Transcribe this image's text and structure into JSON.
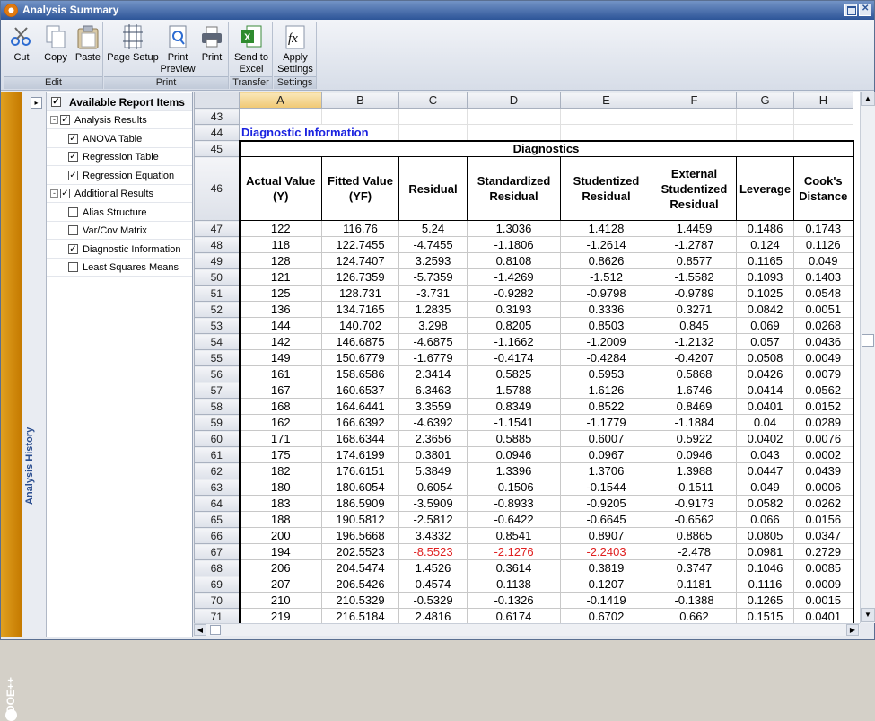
{
  "window": {
    "title": "Analysis Summary"
  },
  "ribbon": {
    "groups": [
      {
        "label": "Edit",
        "buttons": [
          "Cut",
          "Copy",
          "Paste"
        ]
      },
      {
        "label": "Print",
        "buttons": [
          "Page Setup",
          "Print Preview",
          "Print"
        ]
      },
      {
        "label": "Transfer",
        "buttons": [
          "Send to Excel"
        ]
      },
      {
        "label": "Settings",
        "buttons": [
          "Apply Settings"
        ]
      }
    ]
  },
  "sidebar": {
    "history_label": "Analysis History",
    "brand": "DOE++"
  },
  "tree": {
    "header": "Available Report Items",
    "items": [
      {
        "label": "Analysis Results",
        "checked": true,
        "level": 0,
        "expander": "-"
      },
      {
        "label": "ANOVA Table",
        "checked": true,
        "level": 1
      },
      {
        "label": "Regression Table",
        "checked": true,
        "level": 1
      },
      {
        "label": "Regression Equation",
        "checked": true,
        "level": 1
      },
      {
        "label": "Additional Results",
        "checked": true,
        "level": 0,
        "expander": "-"
      },
      {
        "label": "Alias Structure",
        "checked": false,
        "level": 1
      },
      {
        "label": "Var/Cov Matrix",
        "checked": false,
        "level": 1
      },
      {
        "label": "Diagnostic Information",
        "checked": true,
        "level": 1
      },
      {
        "label": "Least Squares Means",
        "checked": false,
        "level": 1
      }
    ]
  },
  "sheet": {
    "columns": [
      "A",
      "B",
      "C",
      "D",
      "E",
      "F",
      "G",
      "H"
    ],
    "selected_column": "A",
    "row_43": "43",
    "row_44": "44",
    "row_45": "45",
    "row_46": "46",
    "section_title": "Diagnostic Information",
    "caption": "Diagnostics",
    "headers": [
      "Actual Value (Y)",
      "Fitted Value (YF)",
      "Residual",
      "Standardized Residual",
      "Studentized Residual",
      "External Studentized Residual",
      "Leverage",
      "Cook's Distance"
    ],
    "negative_color": "#e02020",
    "rows": [
      {
        "n": "47",
        "v": [
          "122",
          "116.76",
          "5.24",
          "1.3036",
          "1.4128",
          "1.4459",
          "0.1486",
          "0.1743"
        ]
      },
      {
        "n": "48",
        "v": [
          "118",
          "122.7455",
          "-4.7455",
          "-1.1806",
          "-1.2614",
          "-1.2787",
          "0.124",
          "0.1126"
        ]
      },
      {
        "n": "49",
        "v": [
          "128",
          "124.7407",
          "3.2593",
          "0.8108",
          "0.8626",
          "0.8577",
          "0.1165",
          "0.049"
        ]
      },
      {
        "n": "50",
        "v": [
          "121",
          "126.7359",
          "-5.7359",
          "-1.4269",
          "-1.512",
          "-1.5582",
          "0.1093",
          "0.1403"
        ]
      },
      {
        "n": "51",
        "v": [
          "125",
          "128.731",
          "-3.731",
          "-0.9282",
          "-0.9798",
          "-0.9789",
          "0.1025",
          "0.0548"
        ]
      },
      {
        "n": "52",
        "v": [
          "136",
          "134.7165",
          "1.2835",
          "0.3193",
          "0.3336",
          "0.3271",
          "0.0842",
          "0.0051"
        ]
      },
      {
        "n": "53",
        "v": [
          "144",
          "140.702",
          "3.298",
          "0.8205",
          "0.8503",
          "0.845",
          "0.069",
          "0.0268"
        ]
      },
      {
        "n": "54",
        "v": [
          "142",
          "146.6875",
          "-4.6875",
          "-1.1662",
          "-1.2009",
          "-1.2132",
          "0.057",
          "0.0436"
        ]
      },
      {
        "n": "55",
        "v": [
          "149",
          "150.6779",
          "-1.6779",
          "-0.4174",
          "-0.4284",
          "-0.4207",
          "0.0508",
          "0.0049"
        ]
      },
      {
        "n": "56",
        "v": [
          "161",
          "158.6586",
          "2.3414",
          "0.5825",
          "0.5953",
          "0.5868",
          "0.0426",
          "0.0079"
        ]
      },
      {
        "n": "57",
        "v": [
          "167",
          "160.6537",
          "6.3463",
          "1.5788",
          "1.6126",
          "1.6746",
          "0.0414",
          "0.0562"
        ]
      },
      {
        "n": "58",
        "v": [
          "168",
          "164.6441",
          "3.3559",
          "0.8349",
          "0.8522",
          "0.8469",
          "0.0401",
          "0.0152"
        ]
      },
      {
        "n": "59",
        "v": [
          "162",
          "166.6392",
          "-4.6392",
          "-1.1541",
          "-1.1779",
          "-1.1884",
          "0.04",
          "0.0289"
        ]
      },
      {
        "n": "60",
        "v": [
          "171",
          "168.6344",
          "2.3656",
          "0.5885",
          "0.6007",
          "0.5922",
          "0.0402",
          "0.0076"
        ]
      },
      {
        "n": "61",
        "v": [
          "175",
          "174.6199",
          "0.3801",
          "0.0946",
          "0.0967",
          "0.0946",
          "0.043",
          "0.0002"
        ]
      },
      {
        "n": "62",
        "v": [
          "182",
          "176.6151",
          "5.3849",
          "1.3396",
          "1.3706",
          "1.3988",
          "0.0447",
          "0.0439"
        ]
      },
      {
        "n": "63",
        "v": [
          "180",
          "180.6054",
          "-0.6054",
          "-0.1506",
          "-0.1544",
          "-0.1511",
          "0.049",
          "0.0006"
        ]
      },
      {
        "n": "64",
        "v": [
          "183",
          "186.5909",
          "-3.5909",
          "-0.8933",
          "-0.9205",
          "-0.9173",
          "0.0582",
          "0.0262"
        ]
      },
      {
        "n": "65",
        "v": [
          "188",
          "190.5812",
          "-2.5812",
          "-0.6422",
          "-0.6645",
          "-0.6562",
          "0.066",
          "0.0156"
        ]
      },
      {
        "n": "66",
        "v": [
          "200",
          "196.5668",
          "3.4332",
          "0.8541",
          "0.8907",
          "0.8865",
          "0.0805",
          "0.0347"
        ]
      },
      {
        "n": "67",
        "v": [
          "194",
          "202.5523",
          "-8.5523",
          "-2.1276",
          "-2.2403",
          "-2.478",
          "0.0981",
          "0.2729"
        ],
        "red": [
          2,
          3,
          4
        ]
      },
      {
        "n": "68",
        "v": [
          "206",
          "204.5474",
          "1.4526",
          "0.3614",
          "0.3819",
          "0.3747",
          "0.1046",
          "0.0085"
        ]
      },
      {
        "n": "69",
        "v": [
          "207",
          "206.5426",
          "0.4574",
          "0.1138",
          "0.1207",
          "0.1181",
          "0.1116",
          "0.0009"
        ]
      },
      {
        "n": "70",
        "v": [
          "210",
          "210.5329",
          "-0.5329",
          "-0.1326",
          "-0.1419",
          "-0.1388",
          "0.1265",
          "0.0015"
        ]
      },
      {
        "n": "71",
        "v": [
          "219",
          "216.5184",
          "2.4816",
          "0.6174",
          "0.6702",
          "0.662",
          "0.1515",
          "0.0401"
        ]
      }
    ]
  }
}
